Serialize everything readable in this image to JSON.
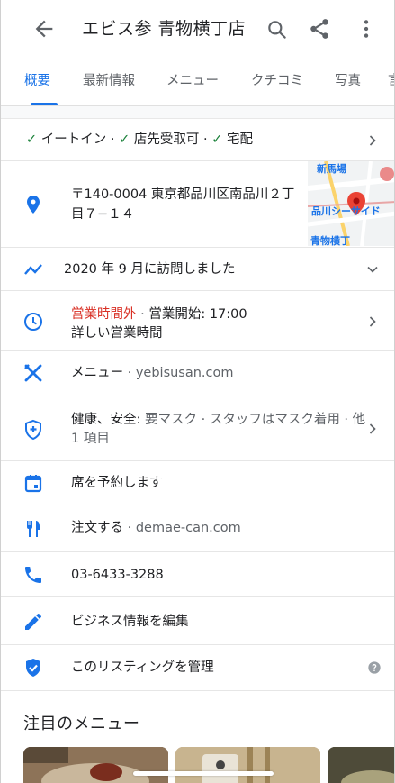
{
  "header": {
    "title": "エビス参 青物横丁店"
  },
  "tabs": [
    "概要",
    "最新情報",
    "メニュー",
    "クチコミ",
    "写真",
    "言"
  ],
  "services": {
    "text": "✓ イートイン · ✓ 店先受取可 · ✓ 宅配",
    "color": "#188038"
  },
  "address": {
    "line1": "〒140-0004 東京都品川区南品川２丁",
    "line2": "目７−１４",
    "map_labels": {
      "station_top": "新馬場",
      "station_mid": "品川シーサイド",
      "station_bottom": "青物横丁"
    }
  },
  "visited": "2020 年 9 月に訪問しました",
  "hours": {
    "status": "営業時間外",
    "separator": " · ",
    "opens": "営業開始: 17:00",
    "detail": "詳しい営業時間"
  },
  "menu": {
    "label": "メニュー",
    "separator": " · ",
    "site": "yebisusan.com"
  },
  "health": {
    "label": "健康、安全:",
    "text": " 要マスク · スタッフはマスク着用 · 他",
    "line2": "1 項目"
  },
  "reserve": "席を予約します",
  "order": {
    "label": "注文する",
    "separator": " · ",
    "site": "demae-can.com"
  },
  "phone": "03-6433-3288",
  "edit": "ビジネス情報を編集",
  "manage": "このリスティングを管理",
  "featured_menu": "注目のメニュー",
  "colors": {
    "accent": "#1a73e8",
    "closed": "#d93025",
    "check": "#188038"
  }
}
